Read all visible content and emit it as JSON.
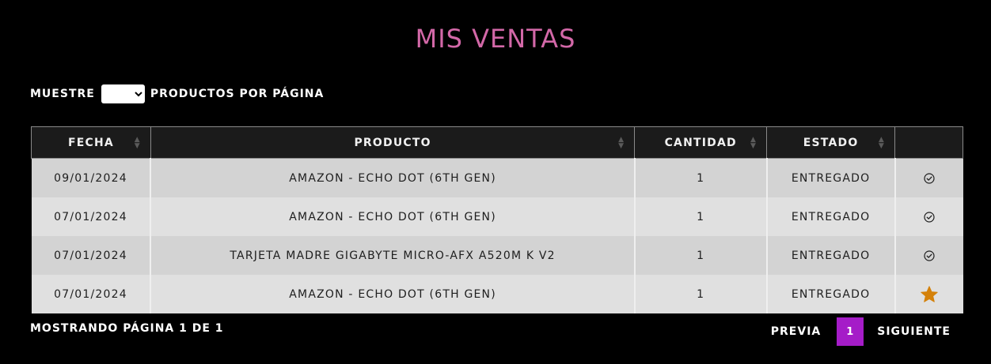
{
  "title": "MIS VENTAS",
  "per_page": {
    "prefix": "MUESTRE",
    "selected": "",
    "suffix": "PRODUCTOS POR PÁGINA"
  },
  "table": {
    "headers": [
      "FECHA",
      "PRODUCTO",
      "CANTIDAD",
      "ESTADO",
      ""
    ],
    "rows": [
      {
        "fecha": "09/01/2024",
        "producto": "AMAZON - ECHO DOT (6TH GEN)",
        "cantidad": "1",
        "estado": "ENTREGADO",
        "action_icon": "check-circle-icon"
      },
      {
        "fecha": "07/01/2024",
        "producto": "AMAZON - ECHO DOT (6TH GEN)",
        "cantidad": "1",
        "estado": "ENTREGADO",
        "action_icon": "check-circle-icon"
      },
      {
        "fecha": "07/01/2024",
        "producto": "TARJETA MADRE GIGABYTE MICRO-AFX A520M K V2",
        "cantidad": "1",
        "estado": "ENTREGADO",
        "action_icon": "check-circle-icon"
      },
      {
        "fecha": "07/01/2024",
        "producto": "AMAZON - ECHO DOT (6TH GEN)",
        "cantidad": "1",
        "estado": "ENTREGADO",
        "action_icon": "star-icon"
      }
    ]
  },
  "footer": {
    "info": "MOSTRANDO PÁGINA 1 DE 1",
    "prev": "PREVIA",
    "current_page": "1",
    "next": "SIGUIENTE"
  },
  "colors": {
    "title": "#d368a8",
    "star": "#d4810a",
    "active_page": "#a51cc8"
  }
}
